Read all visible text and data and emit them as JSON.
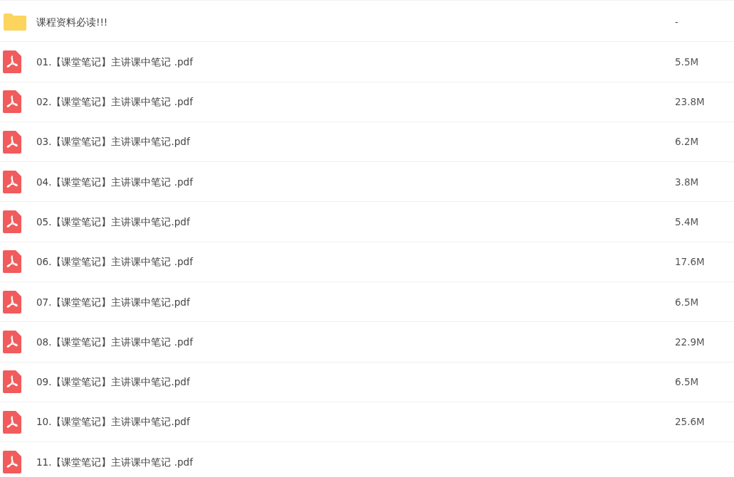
{
  "files": [
    {
      "kind": "folder",
      "name": "课程资料必读!!!",
      "size": "-"
    },
    {
      "kind": "pdf",
      "name": "01.【课堂笔记】主讲课中笔记 .pdf",
      "size": "5.5M"
    },
    {
      "kind": "pdf",
      "name": "02.【课堂笔记】主讲课中笔记 .pdf",
      "size": "23.8M"
    },
    {
      "kind": "pdf",
      "name": "03.【课堂笔记】主讲课中笔记.pdf",
      "size": "6.2M"
    },
    {
      "kind": "pdf",
      "name": "04.【课堂笔记】主讲课中笔记 .pdf",
      "size": "3.8M"
    },
    {
      "kind": "pdf",
      "name": "05.【课堂笔记】主讲课中笔记.pdf",
      "size": "5.4M"
    },
    {
      "kind": "pdf",
      "name": "06.【课堂笔记】主讲课中笔记 .pdf",
      "size": "17.6M"
    },
    {
      "kind": "pdf",
      "name": "07.【课堂笔记】主讲课中笔记.pdf",
      "size": "6.5M"
    },
    {
      "kind": "pdf",
      "name": "08.【课堂笔记】主讲课中笔记 .pdf",
      "size": "22.9M"
    },
    {
      "kind": "pdf",
      "name": "09.【课堂笔记】主讲课中笔记.pdf",
      "size": "6.5M"
    },
    {
      "kind": "pdf",
      "name": "10.【课堂笔记】主讲课中笔记.pdf",
      "size": "25.6M"
    },
    {
      "kind": "pdf",
      "name": "11.【课堂笔记】主讲课中笔记 .pdf"
    }
  ]
}
